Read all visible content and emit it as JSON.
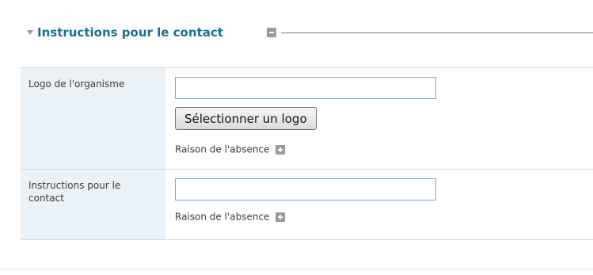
{
  "section": {
    "title": "Instructions pour le contact",
    "toggle_icon": "triangle-down-icon",
    "remove_icon": "minus-box-icon",
    "accent_color": "#1c6f8f"
  },
  "fields": [
    {
      "label": "Logo de l'organisme",
      "input_value": "",
      "button_label": "Sélectionner un logo",
      "absence_label": "Raison de l'absence",
      "absence_icon": "plus-box-icon"
    },
    {
      "label": "Instructions pour le contact",
      "input_value": "",
      "absence_label": "Raison de l'absence",
      "absence_icon": "plus-box-icon"
    }
  ],
  "colors": {
    "label_background": "#eaf2f8",
    "row_border": "#c9dde8",
    "input_border": "#7fa6c7"
  }
}
